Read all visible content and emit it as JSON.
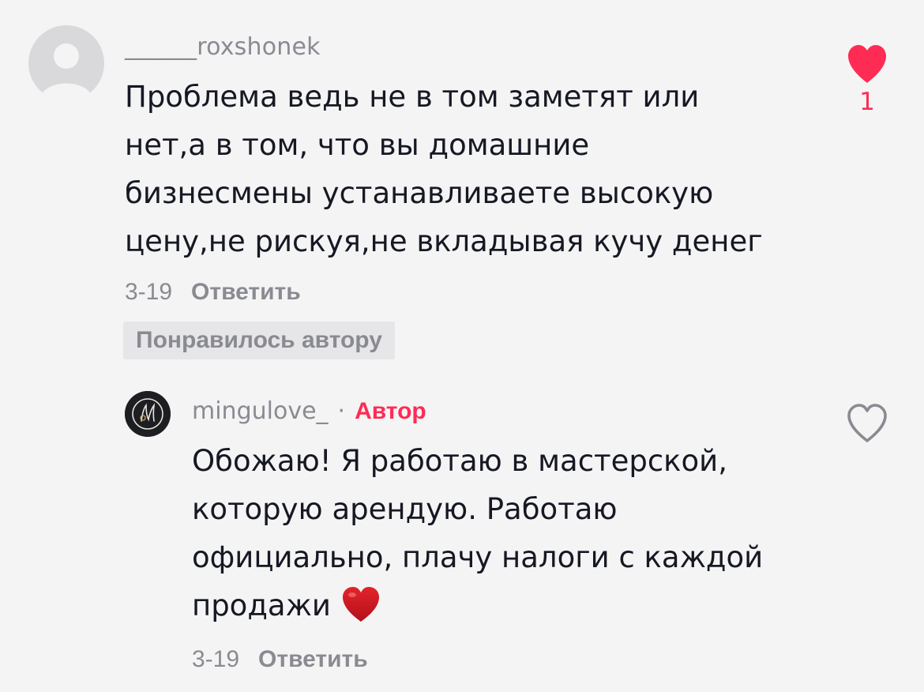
{
  "comment": {
    "username": "______roxshonek",
    "text": "Проблема ведь не в том заметят или\nнет,а в том, что вы домашние\nбизнесмены устанавливаете высокую\nцену,не рискуя,не вкладывая кучу денег",
    "date": "3-19",
    "reply_label": "Ответить",
    "liked_by_author_label": "Понравилось автору",
    "like_count": "1",
    "liked": true,
    "like_color": "#fe2c55"
  },
  "reply": {
    "username": "mingulove_",
    "separator": "·",
    "author_tag": "Автор",
    "text": "Обожаю! Я работаю в мастерской,\nкоторую арендую. Работаю\nофициально, плачу налоги с каждой\nпродажи",
    "emoji": "red-heart-emoji",
    "date": "3-19",
    "reply_label": "Ответить",
    "liked": false
  },
  "icons": {
    "avatar_placeholder": "default-user-avatar-icon",
    "like_filled": "heart-filled-icon",
    "like_outline": "heart-outline-icon"
  },
  "colors": {
    "background": "#f4f4f5",
    "text_primary": "#161823",
    "text_secondary": "#8a8b91",
    "accent": "#fe2c55",
    "badge_bg": "#e6e6e8"
  }
}
